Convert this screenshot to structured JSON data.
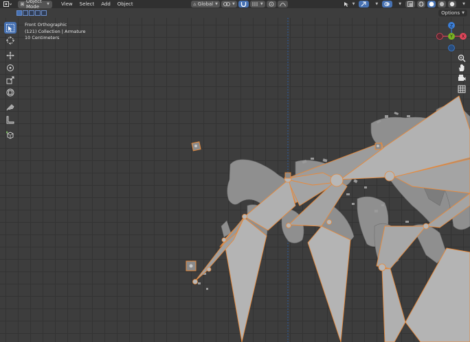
{
  "header": {
    "mode": "Object Mode",
    "menus": [
      "View",
      "Select",
      "Add",
      "Object"
    ],
    "orientation": "Global"
  },
  "subheader": {
    "options_label": "Options"
  },
  "viewport": {
    "view_name": "Front Orthographic",
    "collection": "(121) Collection | Armature",
    "scale": "10 Centimeters"
  },
  "navigation_gizmo": {
    "axis_z": "Z",
    "axis_y": "Y",
    "axis_x": "X"
  },
  "colors": {
    "accent": "#4772b3",
    "selection_outline": "#e8893a",
    "bone_fill": "#a4a4a4",
    "grid_bg": "#3d3d3d",
    "x_axis": "#e0465a",
    "y_axis": "#79b423",
    "z_axis": "#3b7fd9"
  }
}
